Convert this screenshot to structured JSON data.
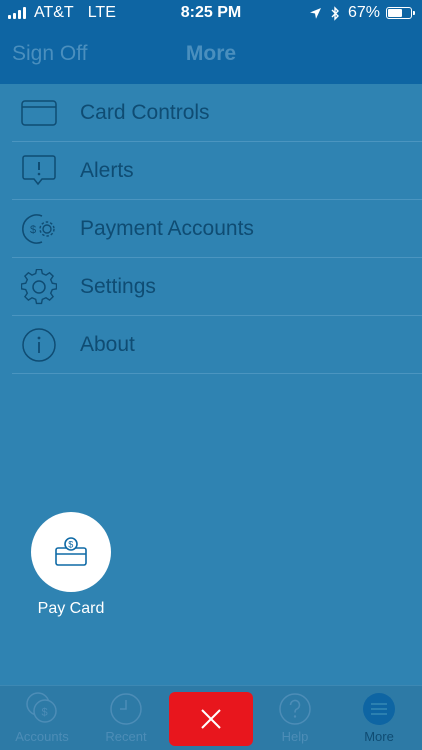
{
  "status_bar": {
    "carrier": "AT&T",
    "network": "LTE",
    "time": "8:25 PM",
    "battery": "67%",
    "battery_level": 0.67
  },
  "nav": {
    "left_button": "Sign Off",
    "title": "More"
  },
  "menu": {
    "items": [
      {
        "label": "Card Controls",
        "icon": "card-icon"
      },
      {
        "label": "Alerts",
        "icon": "alert-bubble-icon"
      },
      {
        "label": "Payment Accounts",
        "icon": "dollar-gear-icon"
      },
      {
        "label": "Settings",
        "icon": "gear-icon"
      },
      {
        "label": "About",
        "icon": "info-icon"
      }
    ]
  },
  "fab": {
    "label": "Pay Card",
    "icon": "pay-card-icon"
  },
  "tabs": [
    {
      "label": "Accounts",
      "icon": "dollar-coins-icon"
    },
    {
      "label": "Recent",
      "icon": "clock-icon"
    },
    {
      "label": "Help",
      "icon": "question-icon"
    },
    {
      "label": "More",
      "icon": "hamburger-icon"
    }
  ],
  "close_button": {
    "icon": "close-icon"
  },
  "colors": {
    "nav_bg": "#0e65a3",
    "overlay_bg": "#2f83b2",
    "close_red": "#e8161d"
  }
}
